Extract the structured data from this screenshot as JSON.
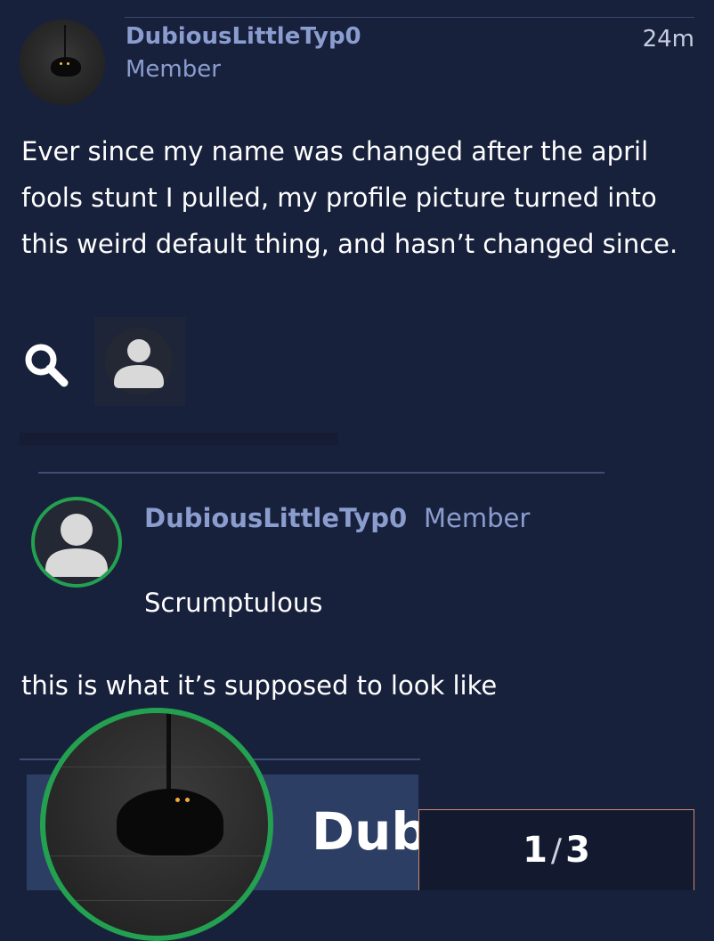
{
  "post": {
    "username": "DubiousLittleTyp0",
    "role": "Member",
    "time": "24m",
    "body": "Ever since my name was changed after the april fools stunt I pulled, my profile picture turned into this weird default thing, and hasn’t changed since."
  },
  "quote": {
    "username": "DubiousLittleTyp0",
    "role": "Member",
    "text": "Scrumptulous"
  },
  "caption": "this is what it’s supposed to look like",
  "preview": {
    "name_fragment": "Dub"
  },
  "lightbox": {
    "current": "1",
    "total": "3"
  },
  "colors": {
    "background": "#18213c",
    "username": "#8b9dcf",
    "online_ring": "#23a050"
  },
  "icons": [
    "search-icon",
    "user-icon",
    "cat-avatar"
  ]
}
